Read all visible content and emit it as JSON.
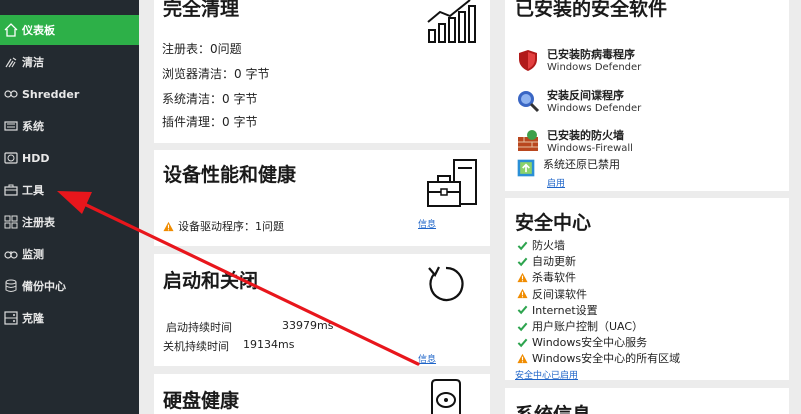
{
  "sidebar": {
    "items": [
      {
        "label": "仪表板",
        "icon": "home-icon"
      },
      {
        "label": "清洁",
        "icon": "broom-icon"
      },
      {
        "label": "Shredder",
        "icon": "shredder-icon"
      },
      {
        "label": "系统",
        "icon": "system-icon"
      },
      {
        "label": "HDD",
        "icon": "hdd-icon"
      },
      {
        "label": "工具",
        "icon": "toolbox-icon"
      },
      {
        "label": "注册表",
        "icon": "registry-icon"
      },
      {
        "label": "监测",
        "icon": "monitor-icon"
      },
      {
        "label": "備份中心",
        "icon": "backup-icon"
      },
      {
        "label": "克隆",
        "icon": "clone-icon"
      }
    ],
    "active_index": 0
  },
  "cleanup": {
    "title": "完全清理",
    "registry": "注册表：0问题",
    "browser": "浏览器清洁：0 字节",
    "system": "系统清洁：0 字节",
    "plugin": "插件清理：0 字节"
  },
  "device": {
    "title": "设备性能和健康",
    "driver": "设备驱动程序：1问题",
    "info_link": "信息"
  },
  "startup": {
    "title": "启动和关闭",
    "boot_label": "启动持续时间",
    "boot_value": "33979ms",
    "shutdown_label": "关机持续时间",
    "shutdown_value": "19134ms",
    "info_link": "信息"
  },
  "disk": {
    "title": "硬盘健康"
  },
  "security_software": {
    "title": "已安装的安全软件",
    "items": [
      {
        "name": "已安装防病毒程序",
        "sub": "Windows Defender",
        "icon": "shield-icon"
      },
      {
        "name": "安装反间谍程序",
        "sub": "Windows Defender",
        "icon": "antispyware-icon"
      },
      {
        "name": "已安装的防火墙",
        "sub": "Windows-Firewall",
        "icon": "firewall-icon"
      },
      {
        "name": "系统还原已禁用",
        "sub": "",
        "icon": "restore-icon"
      }
    ],
    "enable_link": "启用"
  },
  "security_center": {
    "title": "安全中心",
    "items": [
      {
        "label": "防火墙",
        "status": "ok"
      },
      {
        "label": "自动更新",
        "status": "ok"
      },
      {
        "label": "杀毒软件",
        "status": "warn"
      },
      {
        "label": "反间谍软件",
        "status": "warn"
      },
      {
        "label": "Internet设置",
        "status": "ok"
      },
      {
        "label": "用户账户控制（UAC）",
        "status": "ok"
      },
      {
        "label": "Windows安全中心服务",
        "status": "ok"
      },
      {
        "label": "Windows安全中心的所有区域",
        "status": "warn"
      }
    ],
    "enable_link": "安全中心已启用"
  },
  "system_info": {
    "title": "系统信息"
  },
  "colors": {
    "sidebar_bg": "#232a30",
    "active_green": "#2db048",
    "arrow_red": "#e8161c",
    "link_blue": "#1e64c8",
    "ok_green": "#2ea44f",
    "warn_orange": "#f08c00"
  }
}
